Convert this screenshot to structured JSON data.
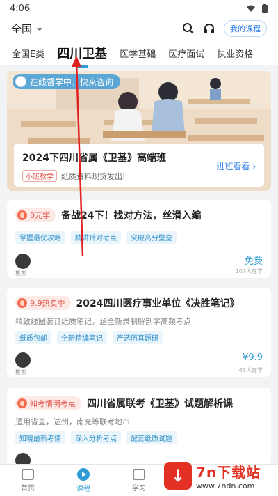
{
  "status": {
    "time": "4:06"
  },
  "header": {
    "region": "全国",
    "my_course": "我的课程"
  },
  "tabs": [
    {
      "label": "全国E类",
      "active": false
    },
    {
      "label": "四川卫基",
      "active": true
    },
    {
      "label": "医学基础",
      "active": false
    },
    {
      "label": "医疗面试",
      "active": false
    },
    {
      "label": "执业资格",
      "active": false
    }
  ],
  "banner": {
    "pill": "在线督学中，快来咨询",
    "title": "2024下四川省属《卫基》高端班",
    "tag": "小班教学",
    "subtitle": "纸质资料现货发出!",
    "link": "进班看看 ›"
  },
  "cards": [
    {
      "badge": "0元学",
      "title": "备战24下！找对方法，丝滑入编",
      "desc": "",
      "tags": [
        "掌握最优攻略",
        "精讲针对考点",
        "突破高分壁垒"
      ],
      "teacher": "熊熊",
      "price": "免费",
      "learners": "107人在学"
    },
    {
      "badge": "9.9热卖中",
      "title": "2024四川医疗事业单位《决胜笔记》",
      "desc": "精致线圈装订纸质笔记，涵全新录制解剖学高频考点",
      "tags": [
        "纸质包邮",
        "全新精编笔记",
        "严选历真题研"
      ],
      "teacher": "熊熊",
      "price": "¥9.9",
      "learners": "63人在学"
    },
    {
      "badge": "知考情明考点",
      "title": "四川省属联考《卫基》试题解析课",
      "desc": "适用省直，达州，南充等联考地市",
      "tags": [
        "知晓最新考情",
        "深入分析考点",
        "配套纸质试题"
      ],
      "teacher": "",
      "price": "",
      "learners": ""
    }
  ],
  "nav": [
    {
      "label": "首页",
      "active": false
    },
    {
      "label": "课程",
      "active": true
    },
    {
      "label": "学习",
      "active": false
    }
  ],
  "watermark": {
    "mark": "↓",
    "title": "7n下载站",
    "url": "www.7ndn.com"
  },
  "colors": {
    "accent": "#2f9bd6",
    "badge": "#e2554a",
    "watermark": "#e23124"
  }
}
